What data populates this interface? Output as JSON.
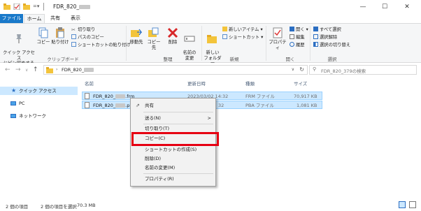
{
  "window": {
    "title": "FDR_820_"
  },
  "tabs": {
    "file": "ファイル",
    "home": "ホーム",
    "share": "共有",
    "view": "表示"
  },
  "ribbon": {
    "quick_access": "クイック アクセス\nにピン留めする",
    "copy": "コピー",
    "paste": "貼り付け",
    "cut": "切り取り",
    "copy_path": "パスのコピー",
    "paste_shortcut": "ショートカットの貼り付け",
    "group_clipboard": "クリップボード",
    "move_to": "移動先",
    "copy_to": "コピー先",
    "delete": "削除",
    "rename": "名前の\n変更",
    "group_organize": "整理",
    "new_folder": "新しい\nフォルダー",
    "new_item": "新しいアイテム ▾",
    "shortcut": "ショートカット ▾",
    "group_new": "新規",
    "properties": "プロパティ",
    "open": "開く ▾",
    "edit": "編集",
    "history": "履歴",
    "group_open": "開く",
    "select_all": "すべて選択",
    "select_none": "選択解除",
    "invert_selection": "選択の切り替え",
    "group_select": "選択"
  },
  "address": {
    "path": "FDR_820_",
    "search_placeholder": "FDR_820_379の検索"
  },
  "nav": {
    "quick_access": "クイック アクセス",
    "pc": "PC",
    "network": "ネットワーク"
  },
  "columns": {
    "name": "名前",
    "modified": "更新日時",
    "type": "種類",
    "size": "サイズ"
  },
  "files": [
    {
      "name_prefix": "FDR_820_",
      "ext": ".frm",
      "modified": "2023/03/02 14:32",
      "type": "FRM ファイル",
      "size": "70,917 KB"
    },
    {
      "name_prefix": "FDR_820_",
      "ext": ".pba",
      "modified": "32",
      "type": "PBA ファイル",
      "size": "1,081 KB"
    }
  ],
  "context_menu": {
    "share": "共有",
    "send_to": "送る(N)",
    "send_to_arrow": ">",
    "cut": "切り取り(T)",
    "copy": "コピー(C)",
    "create_shortcut": "ショートカットの作成(S)",
    "delete": "削除(D)",
    "rename": "名前の変更(M)",
    "properties": "プロパティ(R)"
  },
  "status": {
    "items": "2 個の項目",
    "selected": "2 個の項目を選択",
    "selected_size": "70.3 MB"
  },
  "colors": {
    "accent": "#1979ca",
    "selection": "#cce8ff",
    "highlight": "#e60012"
  }
}
